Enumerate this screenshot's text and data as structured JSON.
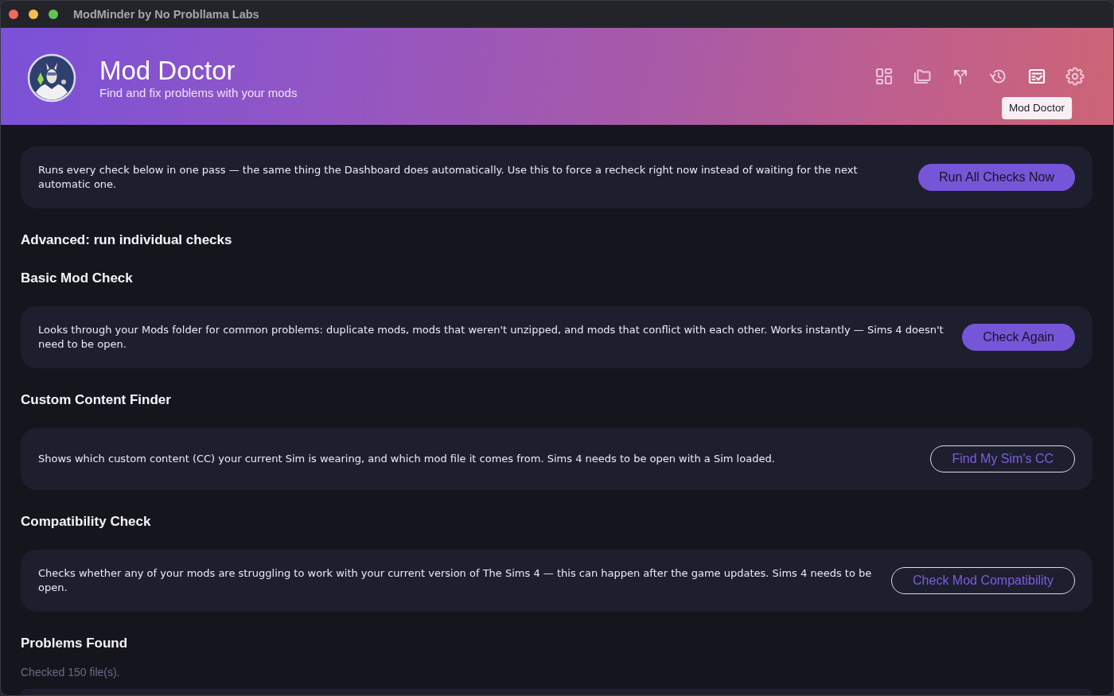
{
  "window": {
    "title": "ModMinder by No Probllama Labs"
  },
  "header": {
    "title": "Mod Doctor",
    "subtitle": "Find and fix problems with your mods",
    "nav": [
      {
        "kind": "grid",
        "selected": false
      },
      {
        "kind": "folders",
        "selected": false
      },
      {
        "kind": "split",
        "selected": false
      },
      {
        "kind": "history",
        "selected": false
      },
      {
        "kind": "checklist",
        "selected": true,
        "tooltip": "Mod Doctor"
      },
      {
        "kind": "gear",
        "selected": false
      }
    ]
  },
  "run_all": {
    "description": "Runs every check below in one pass — the same thing the Dashboard does automatically. Use this to force a recheck right now instead of waiting for the next automatic one.",
    "button": {
      "label": "Run All Checks Now",
      "kind": "primary"
    }
  },
  "advanced_heading": "Advanced: run individual checks",
  "checks": [
    {
      "title": "Basic Mod Check",
      "description": "Looks through your Mods folder for common problems: duplicate mods, mods that weren't unzipped, and mods that conflict with each other. Works instantly — Sims 4 doesn't need to be open.",
      "button": {
        "label": "Check Again",
        "kind": "primary"
      }
    },
    {
      "title": "Custom Content Finder",
      "description": "Shows which custom content (CC) your current Sim is wearing, and which mod file it comes from. Sims 4 needs to be open with a Sim loaded.",
      "button": {
        "label": "Find My Sim's CC",
        "kind": "outline"
      }
    },
    {
      "title": "Compatibility Check",
      "description": "Checks whether any of your mods are struggling to work with your current version of The Sims 4 — this can happen after the game updates. Sims 4 needs to be open.",
      "button": {
        "label": "Check Mod Compatibility",
        "kind": "outline"
      }
    }
  ],
  "problems": {
    "title": "Problems Found",
    "summary": "Checked 150 file(s)."
  }
}
